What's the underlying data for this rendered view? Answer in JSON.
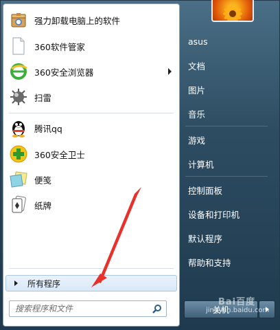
{
  "left_pane": {
    "programs": [
      {
        "label": "强力卸载电脑上的软件",
        "icon": "uninstaller-box-icon"
      },
      {
        "label": "360软件管家",
        "icon": "blank-document-icon"
      },
      {
        "label": "360安全浏览器",
        "icon": "360-browser-icon",
        "has_submenu": true
      },
      {
        "label": "扫雷",
        "icon": "minesweeper-icon"
      },
      {
        "label": "腾讯qq",
        "icon": "qq-penguin-icon"
      },
      {
        "label": "360安全卫士",
        "icon": "360-safeguard-icon"
      },
      {
        "label": "便笺",
        "icon": "sticky-notes-icon"
      },
      {
        "label": "纸牌",
        "icon": "solitaire-cards-icon"
      }
    ],
    "all_programs_label": "所有程序",
    "search_placeholder": "搜索程序和文件"
  },
  "right_pane": {
    "items": [
      {
        "label": "asus"
      },
      {
        "label": "文档"
      },
      {
        "label": "图片"
      },
      {
        "label": "音乐"
      },
      {
        "label": "游戏"
      },
      {
        "label": "计算机"
      },
      {
        "label": "控制面板"
      },
      {
        "label": "设备和打印机"
      },
      {
        "label": "默认程序"
      },
      {
        "label": "帮助和支持"
      }
    ],
    "shutdown_label": "关机"
  },
  "watermark": {
    "logo_text": "Bai百度",
    "url": "jingyan.baidu.com"
  },
  "colors": {
    "accent_red": "#e8312a",
    "menu_highlight": "#d9e8f7"
  }
}
